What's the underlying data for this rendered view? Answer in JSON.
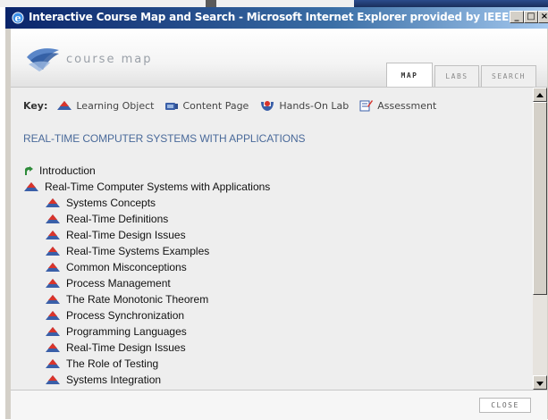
{
  "window": {
    "title": "Interactive Course Map and Search - Microsoft Internet Explorer provided by IEEE",
    "buttons": {
      "minimize": "_",
      "maximize": "□",
      "close": "×"
    }
  },
  "header": {
    "logo_text": "course map",
    "tabs": [
      {
        "label": "MAP",
        "active": true
      },
      {
        "label": "LABS",
        "active": false
      },
      {
        "label": "SEARCH",
        "active": false
      }
    ]
  },
  "key": {
    "label": "Key:",
    "items": [
      {
        "label": "Learning Object",
        "icon": "learning-object-icon"
      },
      {
        "label": "Content Page",
        "icon": "content-page-icon"
      },
      {
        "label": "Hands-On Lab",
        "icon": "hands-on-lab-icon"
      },
      {
        "label": "Assessment",
        "icon": "assessment-icon"
      }
    ]
  },
  "course": {
    "title": "REAL-TIME COMPUTER SYSTEMS WITH APPLICATIONS",
    "items": [
      {
        "label": "Introduction",
        "level": 0,
        "icon": "introduction-icon"
      },
      {
        "label": "Real-Time Computer Systems with Applications",
        "level": 0,
        "icon": "learning-object-icon"
      },
      {
        "label": "Systems Concepts",
        "level": 1,
        "icon": "learning-object-icon"
      },
      {
        "label": "Real-Time Definitions",
        "level": 1,
        "icon": "learning-object-icon"
      },
      {
        "label": "Real-Time Design Issues",
        "level": 1,
        "icon": "learning-object-icon"
      },
      {
        "label": "Real-Time Systems Examples",
        "level": 1,
        "icon": "learning-object-icon"
      },
      {
        "label": "Common Misconceptions",
        "level": 1,
        "icon": "learning-object-icon"
      },
      {
        "label": "Process Management",
        "level": 1,
        "icon": "learning-object-icon"
      },
      {
        "label": "The Rate Monotonic Theorem",
        "level": 1,
        "icon": "learning-object-icon"
      },
      {
        "label": "Process Synchronization",
        "level": 1,
        "icon": "learning-object-icon"
      },
      {
        "label": "Programming Languages",
        "level": 1,
        "icon": "learning-object-icon"
      },
      {
        "label": "Real-Time Design Issues",
        "level": 1,
        "icon": "learning-object-icon"
      },
      {
        "label": "The Role of Testing",
        "level": 1,
        "icon": "learning-object-icon"
      },
      {
        "label": "Systems Integration",
        "level": 1,
        "icon": "learning-object-icon"
      }
    ]
  },
  "footer": {
    "close_label": "CLOSE"
  },
  "colors": {
    "title_bar": "#0a246a",
    "course_title": "#4a6a9a",
    "learning_object_red": "#d9342b",
    "learning_object_blue": "#3a5fa8"
  }
}
